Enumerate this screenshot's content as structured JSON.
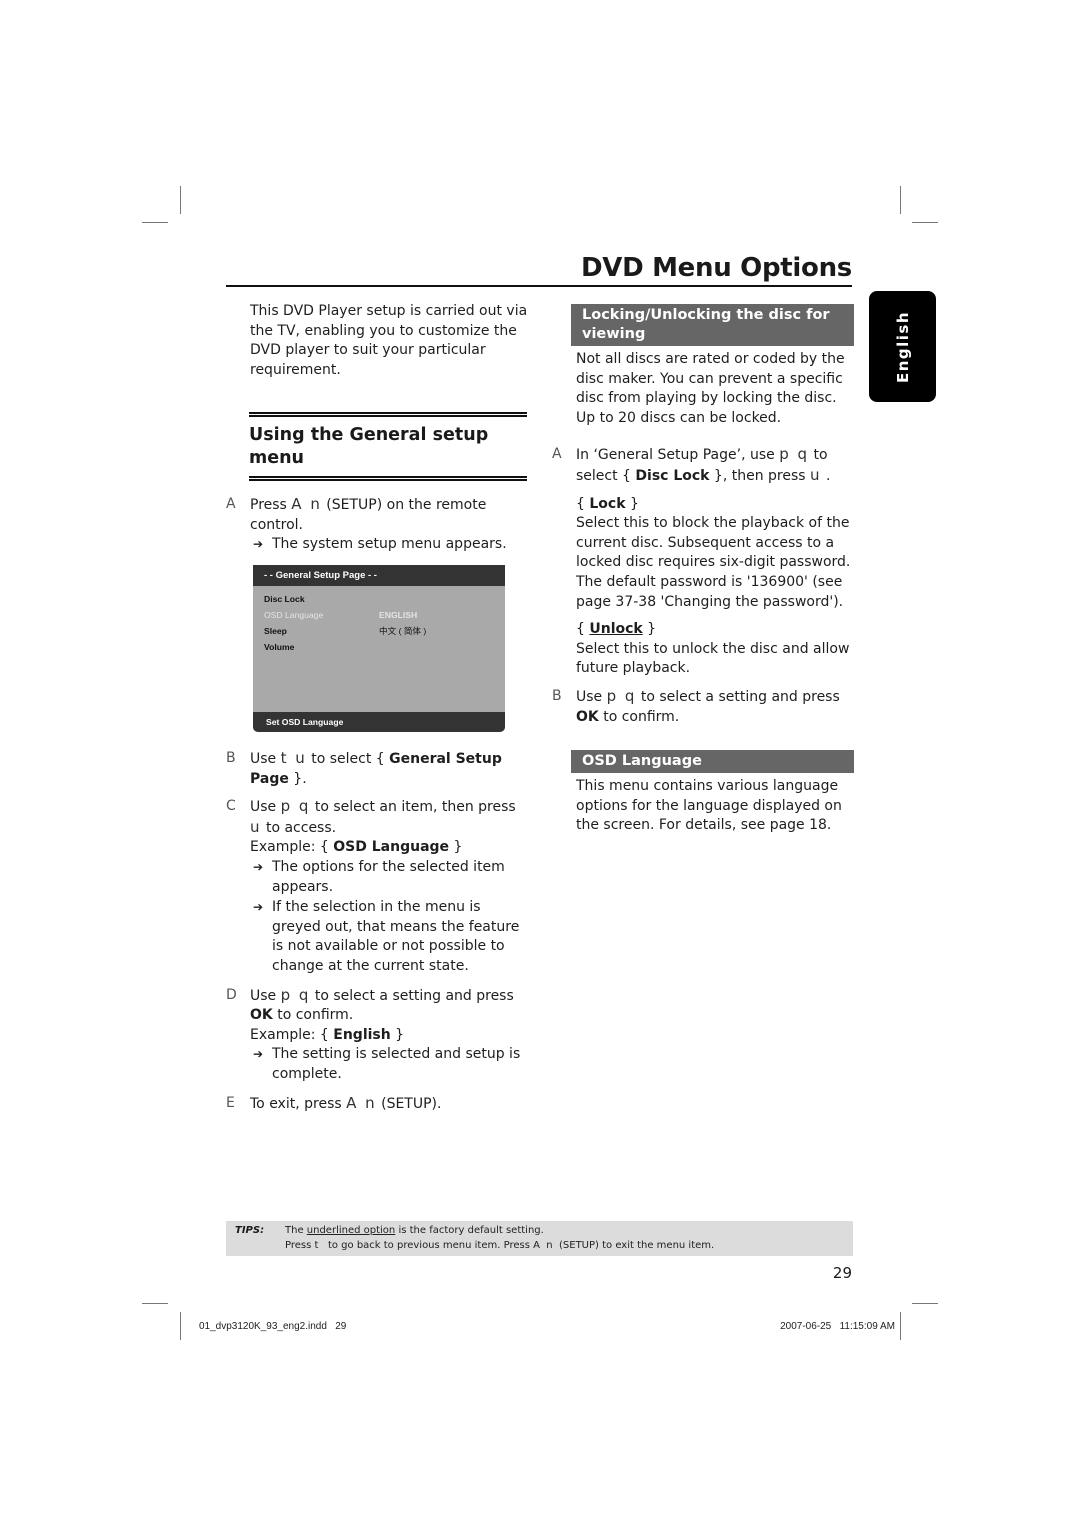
{
  "header": {
    "title": "DVD Menu Options"
  },
  "side_tab": {
    "label": "English"
  },
  "left": {
    "intro": "This DVD Player setup is carried out via the TV, enabling you to customize the DVD player to suit your particular requirement.",
    "section_title": "Using the General setup menu",
    "steps": [
      {
        "letter": "A",
        "text_1": "Press ",
        "sym": "A n",
        "text_2": " (SETUP) on the remote control.",
        "result": "The system setup menu appears."
      },
      {
        "letter": "B",
        "text_1": "Use ",
        "sym": "t u",
        "text_2": " to select { ",
        "bold": "General Setup Page",
        "text_3": " }."
      },
      {
        "letter": "C",
        "text_1": "Use ",
        "sym": "p q",
        "text_2": " to select an item, then press ",
        "sym2": "u",
        "text_3": " to access.",
        "example_prefix": "Example: { ",
        "example_bold": "OSD Language",
        "example_suffix": " }",
        "results": [
          "The options for the selected item appears.",
          "If the selection in the menu is greyed out, that means the feature is not available or not possible to change at the current state."
        ]
      },
      {
        "letter": "D",
        "text_1": "Use ",
        "sym": "p q",
        "text_2": " to select a setting and press ",
        "bold": "OK",
        "text_3": " to confirm.",
        "example_prefix": "Example: { ",
        "example_bold": "English",
        "example_suffix": " }",
        "result": "The setting is selected and setup is complete."
      },
      {
        "letter": "E",
        "text_1": "To exit, press ",
        "sym": "A n",
        "text_2": " (SETUP)."
      }
    ]
  },
  "menu_screen": {
    "header": "- -   General Setup Page   - -",
    "rows": [
      {
        "label": "Disc Lock",
        "value": ""
      },
      {
        "label": "OSD Language",
        "value": "ENGLISH",
        "greyed": true
      },
      {
        "label": "Sleep",
        "value": "中文 ( 简体 )"
      },
      {
        "label": "Volume",
        "value": ""
      }
    ],
    "footer": "Set OSD Language"
  },
  "right": {
    "lock_section": {
      "title": "Locking/Unlocking the disc for viewing",
      "intro": "Not all discs are rated or coded by the disc maker. You can prevent a specific disc from playing by locking the disc. Up to 20 discs can be locked.",
      "step_a": {
        "letter": "A",
        "text_1": "In ‘General Setup Page’, use ",
        "sym": "p q",
        "text_2": " to select { ",
        "bold": "Disc Lock",
        "text_3": " }, then press ",
        "sym2": "u",
        "text_4": " ."
      },
      "lock_option": {
        "label": "Lock",
        "desc": "Select this to block the playback of the current disc. Subsequent access to a locked disc requires six-digit password. The default password is '136900' (see page 37-38 'Changing the password')."
      },
      "unlock_option": {
        "label": "Unlock",
        "desc": "Select this to unlock the disc and allow future playback."
      },
      "step_b": {
        "letter": "B",
        "text_1": "Use ",
        "sym": "p q",
        "text_2": " to select a setting and press ",
        "bold": "OK",
        "text_3": " to confirm."
      }
    },
    "osd_section": {
      "title": "OSD Language",
      "desc": "This menu contains various language options for the language displayed on the screen. For details, see page 18."
    }
  },
  "tips": {
    "label": "TIPS:",
    "line1_a": "The ",
    "line1_u": "underlined option",
    "line1_b": " is the factory default setting.",
    "line2": "Press t   to go back to previous menu item. Press A  n  (SETUP) to exit the menu item."
  },
  "footer": {
    "page_number": "29",
    "slug_file": "01_dvp3120K_93_eng2.indd   29",
    "slug_date": "2007-06-25   11:15:09 AM"
  }
}
